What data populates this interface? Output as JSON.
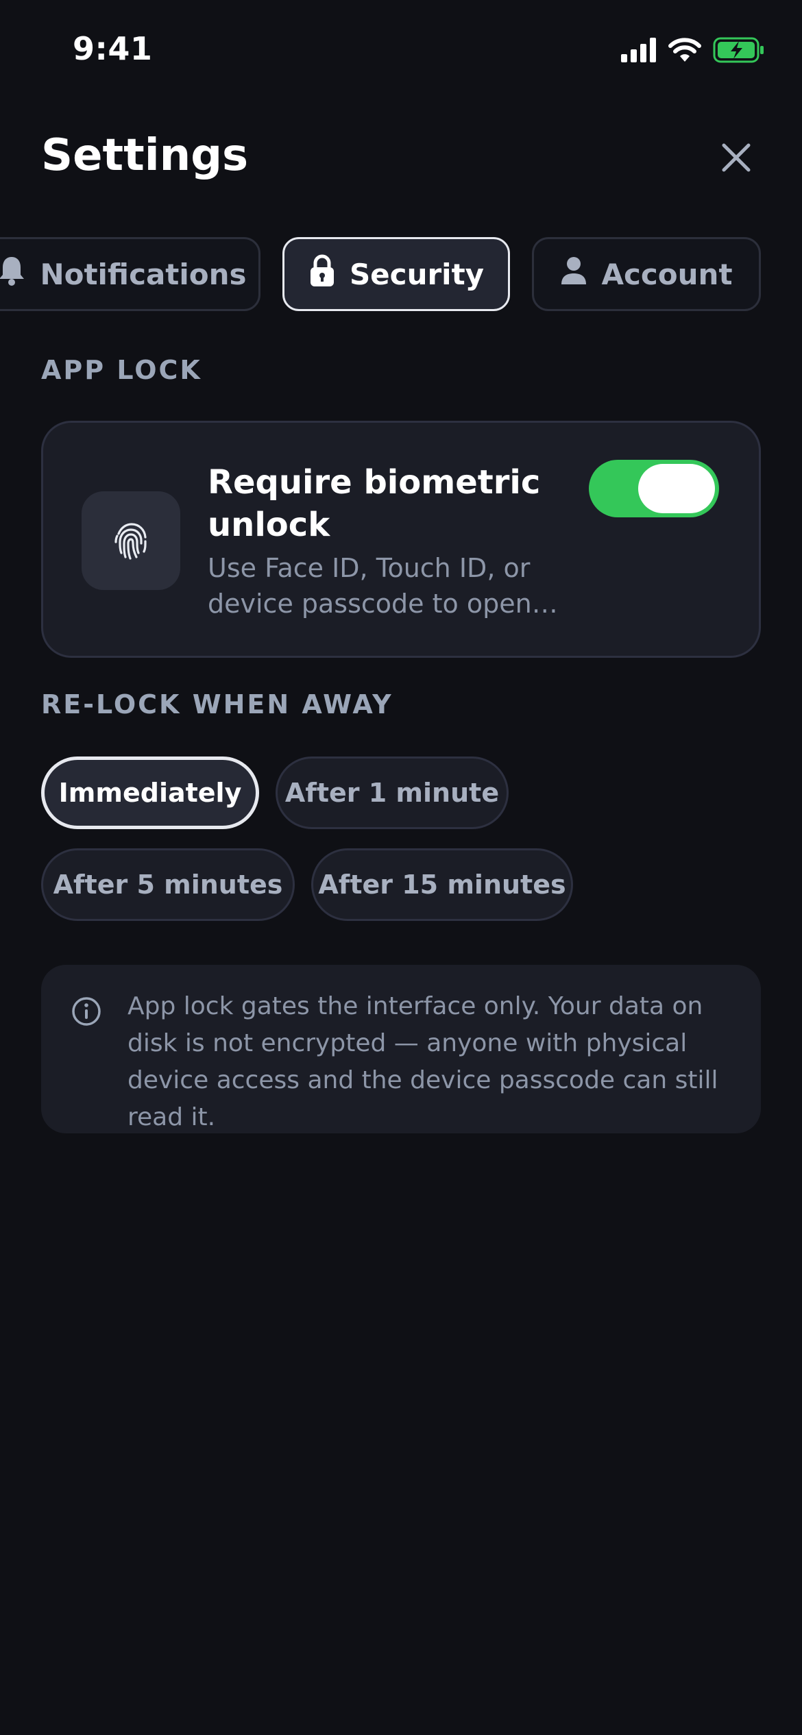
{
  "status_bar": {
    "time": "9:41",
    "icons": [
      "cellular-signal-icon",
      "wifi-icon",
      "battery-charging-icon"
    ],
    "battery_color": "#34c759"
  },
  "header": {
    "title": "Settings",
    "close_icon": "close-icon"
  },
  "tabs": [
    {
      "label": "Notifications",
      "icon": "bell-icon",
      "active": false
    },
    {
      "label": "Security",
      "icon": "lock-icon",
      "active": true
    },
    {
      "label": "Account",
      "icon": "person-icon",
      "active": false
    }
  ],
  "app_lock": {
    "section_label": "APP LOCK",
    "biometric": {
      "icon": "fingerprint-icon",
      "title": "Require biometric unlock",
      "description": "Use Face ID, Touch ID, or device passcode to open the app",
      "enabled": true,
      "toggle_color": "#34c759"
    }
  },
  "relock": {
    "section_label": "RE-LOCK WHEN AWAY",
    "options": [
      {
        "label": "Immediately",
        "selected": true
      },
      {
        "label": "After 1 minute",
        "selected": false
      },
      {
        "label": "After 5 minutes",
        "selected": false
      },
      {
        "label": "After 15 minutes",
        "selected": false
      }
    ]
  },
  "info": {
    "icon": "info-icon",
    "text": "App lock gates the interface only. Your data on disk is not encrypted — anyone with physical device access and the device passcode can still read it."
  }
}
